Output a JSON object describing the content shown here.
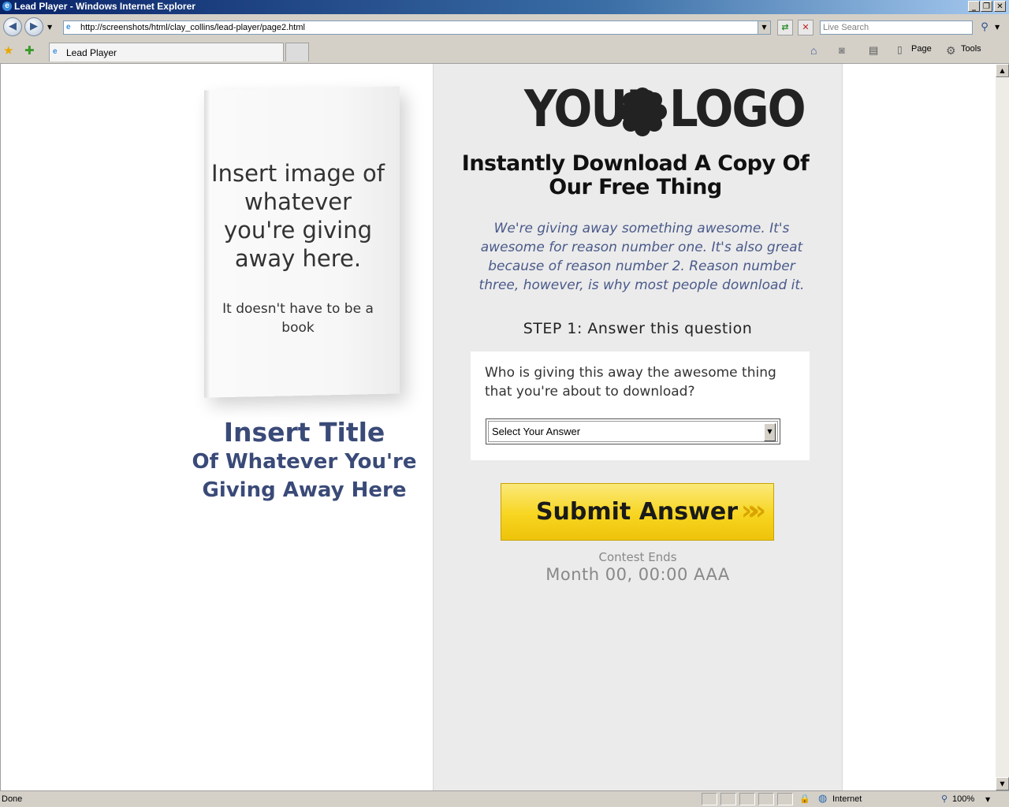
{
  "window": {
    "title": "Lead Player - Windows Internet Explorer",
    "controls": [
      "_",
      "❐",
      "✕"
    ]
  },
  "browser": {
    "url": "http://screenshots/html/clay_collins/lead-player/page2.html",
    "search_placeholder": "Live Search",
    "tab_label": "Lead Player",
    "tools": {
      "page": "Page",
      "tools": "Tools"
    },
    "status_text": "Done",
    "zone": "Internet",
    "zoom": "100%"
  },
  "left": {
    "book_text_main": "Insert image of whatever you're giving away here.",
    "book_text_sub": "It doesn't have to be a book",
    "title_line1": "Insert Title",
    "title_line2": "Of Whatever You're Giving Away Here"
  },
  "right": {
    "logo_left": "YOUR",
    "logo_right": "LOGO",
    "headline": "Instantly Download A Copy Of Our Free Thing",
    "description": "We're giving away something awesome. It's awesome for reason number one. It's also great because of reason number 2. Reason number three, however, is why most people download it.",
    "step": "STEP 1: Answer this question",
    "question": "Who is giving this away the awesome thing that you're about to download?",
    "select_value": "Select Your Answer",
    "submit_label": "Submit Answer",
    "contest_ends_label": "Contest Ends",
    "contest_ends_date": "Month 00, 00:00 AAA"
  },
  "colors": {
    "title_blue": "#3a4a78",
    "desc_blue": "#4a5a8a",
    "button_yellow": "#f7d520",
    "panel_bg": "#ebebeb"
  }
}
